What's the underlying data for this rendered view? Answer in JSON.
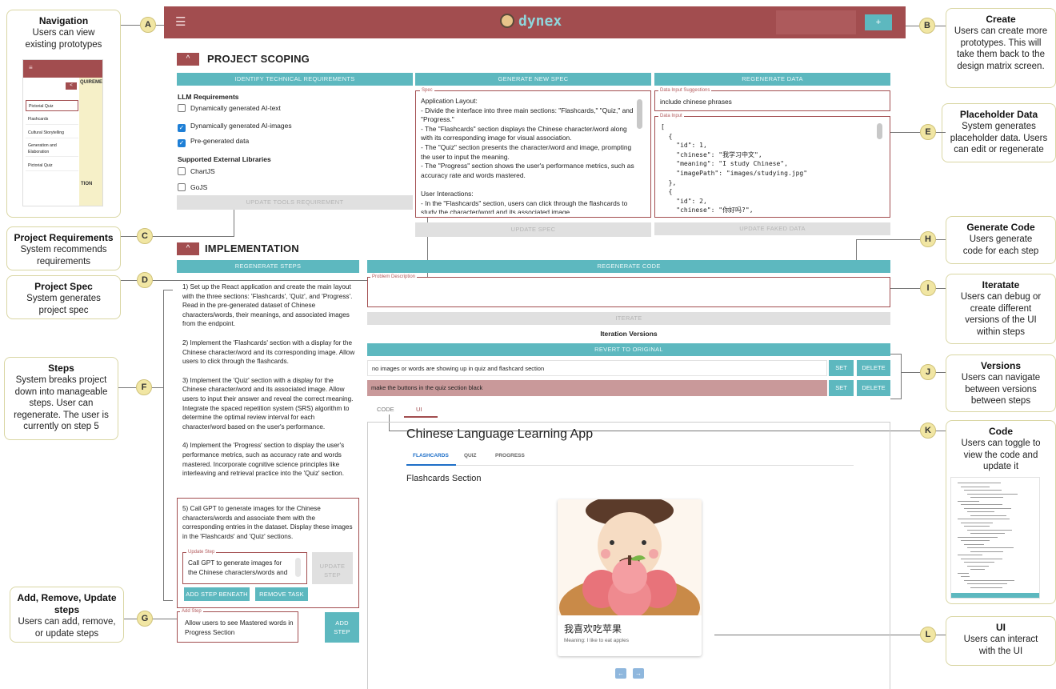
{
  "app": {
    "logo_text": "dynex",
    "create_button": "+",
    "sections": {
      "scoping": "PROJECT SCOPING",
      "implementation": "IMPLEMENTATION"
    },
    "collapse_icon": "^"
  },
  "scoping": {
    "col1": {
      "header": "IDENTIFY TECHNICAL REQUIREMENTS",
      "llm_title": "LLM Requirements",
      "llm_items": [
        {
          "label": "Dynamically generated AI-text",
          "checked": false
        },
        {
          "label": "Dynamically generated AI-images",
          "checked": true
        },
        {
          "label": "Pre-generated data",
          "checked": true
        }
      ],
      "libs_title": "Supported External Libraries",
      "libs_items": [
        {
          "label": "ChartJS",
          "checked": false
        },
        {
          "label": "GoJS",
          "checked": false
        }
      ],
      "update_button": "UPDATE TOOLS REQUIREMENT"
    },
    "col2": {
      "header": "GENERATE NEW SPEC",
      "legend": "Spec",
      "text": "Application Layout:\n- Divide the interface into three main sections: \"Flashcards,\" \"Quiz,\" and \"Progress.\"\n- The \"Flashcards\" section displays the Chinese character/word along with its corresponding image for visual association.\n- The \"Quiz\" section presents the character/word and image, prompting the user to input the meaning.\n- The \"Progress\" section shows the user's performance metrics, such as accuracy rate and words mastered.\n\nUser Interactions:\n- In the \"Flashcards\" section, users can click through the flashcards to study the character/word and its associated image.",
      "update_button": "UPDATE SPEC"
    },
    "col3": {
      "header": "REGENERATE DATA",
      "suggest_legend": "Data Input Suggestions",
      "suggest_value": "include chinese phrases",
      "data_legend": "Data Input",
      "data_text": "[\n  {\n    \"id\": 1,\n    \"chinese\": \"我学习中文\",\n    \"meaning\": \"I study Chinese\",\n    \"imagePath\": \"images/studying.jpg\"\n  },\n  {\n    \"id\": 2,\n    \"chinese\": \"你好吗?\",",
      "update_button": "UPDATE FAKED DATA"
    }
  },
  "implementation": {
    "steps_header": "REGENERATE STEPS",
    "steps": [
      "1) Set up the React application and create the main layout with the three sections: 'Flashcards', 'Quiz', and 'Progress'. Read in the pre-generated dataset of Chinese characters/words, their meanings, and associated images from the endpoint.",
      "2) Implement the 'Flashcards' section with a display for the Chinese character/word and its corresponding image. Allow users to click through the flashcards.",
      "3) Implement the 'Quiz' section with a display for the Chinese character/word and its associated image. Allow users to input their answer and reveal the correct meaning. Integrate the spaced repetition system (SRS) algorithm to determine the optimal review interval for each character/word based on the user's performance.",
      "4) Implement the 'Progress' section to display the user's performance metrics, such as accuracy rate and words mastered. Incorporate cognitive science principles like interleaving and retrieval practice into the 'Quiz' section."
    ],
    "current_step": "5) Call GPT to generate images for the Chinese characters/words and associate them with the corresponding entries in the dataset. Display these images in the 'Flashcards' and 'Quiz' sections.",
    "update_step_legend": "Update Step",
    "update_step_value": "Call GPT to generate images for the Chinese characters/words and",
    "update_step_button": "UPDATE STEP",
    "add_beneath_button": "ADD STEP BENEATH",
    "remove_button": "REMOVE TASK",
    "add_step_legend": "Add Step",
    "add_step_value": "Allow users to see Mastered words in Progress Section",
    "add_step_button": "ADD STEP",
    "code_header": "REGENERATE CODE",
    "problem_legend": "Problem Description",
    "iterate_button": "ITERATE",
    "versions_title": "Iteration Versions",
    "revert_button": "REVERT TO ORIGINAL",
    "versions": [
      {
        "text": "no images or words are showing up in quiz and flashcard section",
        "set": "SET",
        "delete": "DELETE",
        "selected": false
      },
      {
        "text": "make the buttons in the quiz section black",
        "set": "SET",
        "delete": "DELETE",
        "selected": true
      }
    ],
    "tabs": [
      "CODE",
      "UI"
    ]
  },
  "preview": {
    "title": "Chinese Language Learning App",
    "tabs": [
      "FLASHCARDS",
      "QUIZ",
      "PROGRESS"
    ],
    "section_title": "Flashcards Section",
    "card_chinese": "我喜欢吃苹果",
    "card_meaning": "Meaning: I like to eat apples"
  },
  "mini_nav": {
    "menu_icon": "≡",
    "back": "<",
    "partial_a": "QUIREME",
    "partial_b": "TION",
    "items": [
      "Pictorial Quiz",
      "Flashcards",
      "Cultural Storytelling",
      "Generation and Elaboration",
      "Pictorial Quiz"
    ]
  },
  "callouts": [
    {
      "id": "A",
      "title": "Navigation",
      "desc": "Users can view existing prototypes"
    },
    {
      "id": "B",
      "title": "Create",
      "desc": "Users can create more prototypes. This will take them back to the design matrix screen."
    },
    {
      "id": "C",
      "title": "Project Requirements",
      "desc": "System recommends requirements"
    },
    {
      "id": "D",
      "title": "Project Spec",
      "desc": "System generates project spec"
    },
    {
      "id": "E",
      "title": "Placeholder Data",
      "desc": "System generates placeholder data. Users can edit or regenerate"
    },
    {
      "id": "F",
      "title": "Steps",
      "desc": "System breaks project down into manageable steps. User can regenerate. The user is currently on step 5"
    },
    {
      "id": "G",
      "title": "Add, Remove, Update steps",
      "desc": "Users can add, remove, or update steps"
    },
    {
      "id": "H",
      "title": "Generate Code",
      "desc": "Users generate code for each step"
    },
    {
      "id": "I",
      "title": "Iteratate",
      "desc": "Users can debug or create different versions of the UI within steps"
    },
    {
      "id": "J",
      "title": "Versions",
      "desc": "Users can navigate between versions between steps"
    },
    {
      "id": "K",
      "title": "Code",
      "desc": "Users can toggle to view the code and update it"
    },
    {
      "id": "L",
      "title": "UI",
      "desc": "Users can interact with the UI"
    }
  ],
  "colors": {
    "brand": "#a24d4f",
    "accent": "#5db8bf",
    "marker": "#f1e6a3"
  }
}
